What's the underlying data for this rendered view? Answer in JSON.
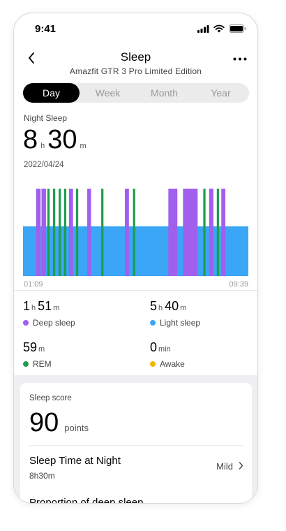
{
  "status_bar": {
    "time": "9:41"
  },
  "nav": {
    "title": "Sleep",
    "subtitle": "Amazfit GTR 3 Pro Limited Edition"
  },
  "tabs": [
    {
      "label": "Day",
      "active": true
    },
    {
      "label": "Week",
      "active": false
    },
    {
      "label": "Month",
      "active": false
    },
    {
      "label": "Year",
      "active": false
    }
  ],
  "night_sleep": {
    "label": "Night Sleep",
    "hours": "8",
    "hours_unit": "h",
    "minutes": "30",
    "minutes_unit": "m",
    "date": "2022/04/24",
    "start_time": "01:09",
    "end_time": "09:39"
  },
  "chart_data": {
    "type": "area",
    "x_range": [
      "01:09",
      "09:39"
    ],
    "segments_note": "",
    "stages": [
      {
        "stage": "light",
        "start": 0.0,
        "end": 1.0
      },
      {
        "stage": "deep",
        "start": 0.058,
        "end": 0.078
      },
      {
        "stage": "deep",
        "start": 0.082,
        "end": 0.102
      },
      {
        "stage": "rem",
        "start": 0.108,
        "end": 0.118
      },
      {
        "stage": "rem",
        "start": 0.133,
        "end": 0.143
      },
      {
        "stage": "rem",
        "start": 0.158,
        "end": 0.168
      },
      {
        "stage": "rem",
        "start": 0.182,
        "end": 0.192
      },
      {
        "stage": "deep",
        "start": 0.204,
        "end": 0.222
      },
      {
        "stage": "rem",
        "start": 0.235,
        "end": 0.245
      },
      {
        "stage": "deep",
        "start": 0.285,
        "end": 0.302
      },
      {
        "stage": "rem",
        "start": 0.347,
        "end": 0.357
      },
      {
        "stage": "deep",
        "start": 0.452,
        "end": 0.47
      },
      {
        "stage": "rem",
        "start": 0.488,
        "end": 0.498
      },
      {
        "stage": "deep",
        "start": 0.645,
        "end": 0.685
      },
      {
        "stage": "deep",
        "start": 0.71,
        "end": 0.775
      },
      {
        "stage": "rem",
        "start": 0.8,
        "end": 0.81
      },
      {
        "stage": "deep",
        "start": 0.826,
        "end": 0.845
      },
      {
        "stage": "rem",
        "start": 0.86,
        "end": 0.87
      },
      {
        "stage": "deep",
        "start": 0.88,
        "end": 0.898
      }
    ],
    "colors": {
      "light": "#3aa6f5",
      "deep": "#a15fee",
      "rem": "#1f9d4c"
    }
  },
  "stats": {
    "deep": {
      "h": "1",
      "h_unit": "h",
      "m": "51",
      "m_unit": "m",
      "label": "Deep sleep",
      "color": "#a15fee"
    },
    "light": {
      "h": "5",
      "h_unit": "h",
      "m": "40",
      "m_unit": "m",
      "label": "Light sleep",
      "color": "#3aa6f5"
    },
    "rem": {
      "m": "59",
      "m_unit": "m",
      "label": "REM",
      "color": "#1f9d4c"
    },
    "awake": {
      "m": "0",
      "m_unit": "min",
      "label": "Awake",
      "color": "#f5b400"
    }
  },
  "score_card": {
    "label": "Sleep score",
    "score": "90",
    "unit": "points",
    "rows": [
      {
        "title": "Sleep Time at Night",
        "value": "8h30m",
        "status": "Mild"
      },
      {
        "title": "Proportion of deep sleep"
      }
    ]
  }
}
